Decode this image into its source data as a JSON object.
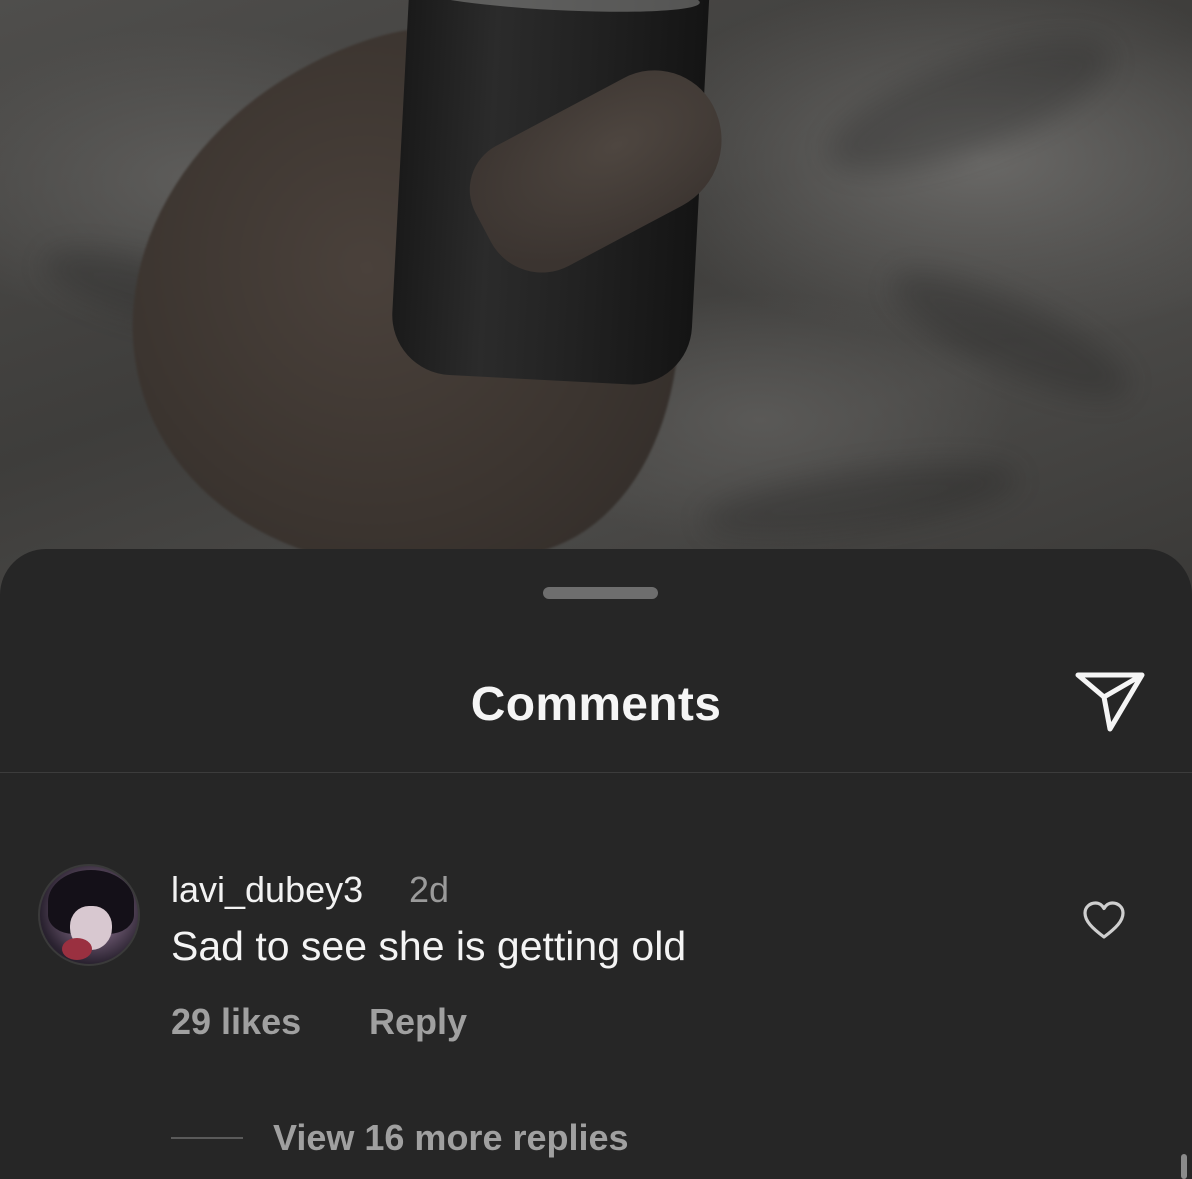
{
  "sheet": {
    "title": "Comments"
  },
  "comment": {
    "username": "lavi_dubey3",
    "timestamp": "2d",
    "text": "Sad to see she is getting old",
    "likes": "29 likes",
    "reply_label": "Reply",
    "view_replies": "View 16 more replies"
  },
  "icons": {
    "share": "paper-plane-icon",
    "like": "heart-outline-icon"
  },
  "colors": {
    "sheet_background": "#262626",
    "primary_text": "#f5f5f5",
    "secondary_text": "#a0a0a0"
  }
}
